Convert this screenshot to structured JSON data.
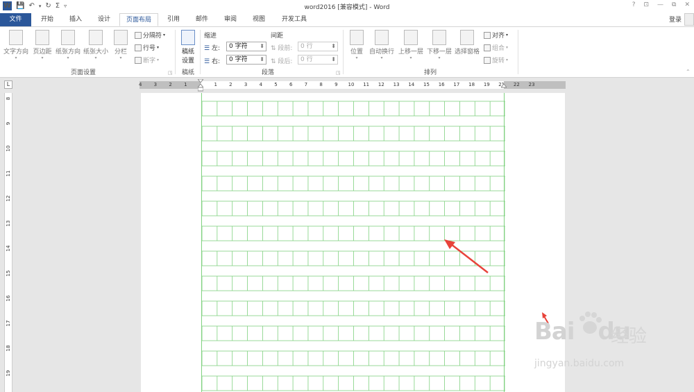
{
  "window": {
    "title": "word2016 [兼容模式] - Word",
    "help": "?",
    "controls": [
      "⊡",
      "—",
      "⧉",
      "✕"
    ]
  },
  "quick_access": {
    "logo": "W",
    "save_icon": "save-icon",
    "undo_icon": "undo-icon",
    "redo_icon": "redo-icon",
    "sigma_icon": "sigma-icon",
    "customize_icon": "customize-icon"
  },
  "tabs": [
    {
      "label": "文件"
    },
    {
      "label": "开始"
    },
    {
      "label": "插入"
    },
    {
      "label": "设计"
    },
    {
      "label": "页面布局"
    },
    {
      "label": "引用"
    },
    {
      "label": "邮件"
    },
    {
      "label": "审阅"
    },
    {
      "label": "视图"
    },
    {
      "label": "开发工具"
    }
  ],
  "account": {
    "login": "登录"
  },
  "ribbon": {
    "page_setup": {
      "label": "页面设置",
      "buttons": [
        "文字方向",
        "页边距",
        "纸张方向",
        "纸张大小",
        "分栏"
      ],
      "breaks": "分隔符",
      "line_numbers": "行号",
      "hyphenation": "断字"
    },
    "manuscript": {
      "label": "稿纸",
      "button_line1": "稿纸",
      "button_line2": "设置"
    },
    "paragraph": {
      "label": "段落",
      "indent_title": "缩进",
      "spacing_title": "间距",
      "left_label": "左:",
      "left_value": "0 字符",
      "right_label": "右:",
      "right_value": "0 字符",
      "before_label": "段前:",
      "before_value": "0 行",
      "after_label": "段后:",
      "after_value": "0 行"
    },
    "arrange": {
      "label": "排列",
      "buttons": [
        "位置",
        "自动换行",
        "上移一层",
        "下移一层",
        "选择窗格"
      ],
      "align": "对齐",
      "group": "组合",
      "rotate": "旋转"
    }
  },
  "ruler": {
    "corner": "L",
    "left_numbers": [
      "4",
      "3",
      "2",
      "1"
    ],
    "main_numbers": [
      "1",
      "2",
      "3",
      "4",
      "5",
      "6",
      "7",
      "8",
      "9",
      "10",
      "11",
      "12",
      "13",
      "14",
      "15",
      "16",
      "17",
      "18",
      "19"
    ],
    "right_numbers": [
      "21",
      "22",
      "23"
    ],
    "vertical_numbers": [
      "8",
      "9",
      "10",
      "11",
      "12",
      "13",
      "14",
      "15",
      "16",
      "17",
      "18",
      "19"
    ]
  },
  "watermark": {
    "logo": "Bai",
    "logo2": "du",
    "chinese": "经验",
    "url": "jingyan.baidu.com"
  },
  "colors": {
    "accent": "#2b579a",
    "grid": "#7fd17f",
    "arrow": "#e8433a"
  }
}
